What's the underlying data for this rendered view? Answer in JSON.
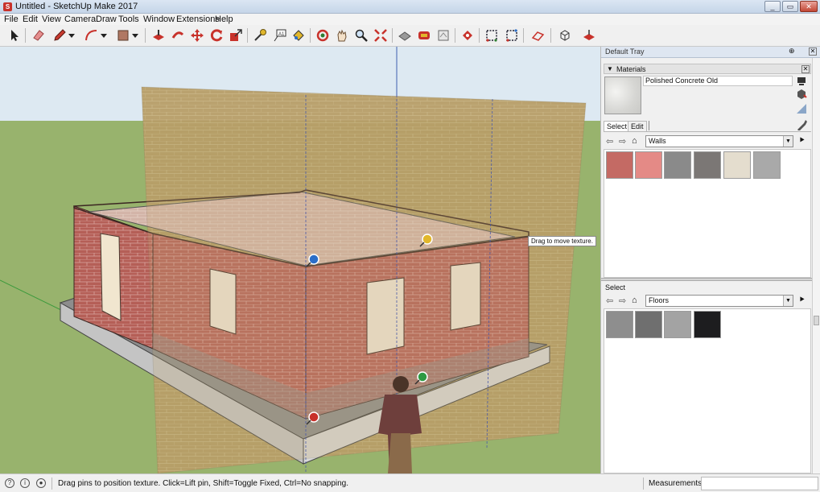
{
  "window": {
    "title": "Untitled - SketchUp Make 2017",
    "app_icon_glyph": "S"
  },
  "window_controls": [
    "minimize-button",
    "maximize-button",
    "close-button"
  ],
  "menu": [
    "File",
    "Edit",
    "View",
    "Camera",
    "Draw",
    "Tools",
    "Window",
    "Extensions",
    "Help"
  ],
  "toolbar_icons": [
    "select-icon",
    "eraser-icon",
    "pencil-icon",
    "arc-icon",
    "rectangle-icon",
    "push-pull-icon",
    "follow-me-icon",
    "move-icon",
    "rotate-icon",
    "scale-icon",
    "tape-measure-icon",
    "text-icon",
    "paint-bucket-icon",
    "orbit-icon",
    "pan-icon",
    "zoom-icon",
    "zoom-extents-icon",
    "3d-warehouse-icon",
    "extension-warehouse-icon",
    "layout-icon",
    "extension-manager-icon",
    "section-plane-icon",
    "section-display-icon",
    "axes-icon",
    "iso-view-icon",
    "top-view-icon"
  ],
  "viewport": {
    "tooltip": "Drag to move texture.",
    "pins": [
      "blue-pin-icon",
      "yellow-pin-icon",
      "green-pin-icon",
      "red-pin-icon"
    ]
  },
  "tray": {
    "title": "Default Tray",
    "materials_title": "Materials",
    "material_name": "Polished Concrete Old",
    "tabs": {
      "select": "Select",
      "edit": "Edit"
    },
    "upper_collection": "Walls",
    "lower_label": "Select",
    "lower_collection": "Floors",
    "wall_swatches": [
      "#c46a64",
      "#e48a86",
      "#8a8a8a",
      "#7b7775",
      "#e4ddce",
      "#a9a9a9"
    ],
    "floor_swatches": [
      "#8e8e8e",
      "#6f6f6f",
      "#a3a3a3",
      "#1d1d1f"
    ]
  },
  "status": {
    "text": "Drag pins to position texture.  Click=Lift pin, Shift=Toggle Fixed, Ctrl=No snapping.",
    "measurements_label": "Measurements",
    "measurements_value": ""
  },
  "colors": {
    "sky": "#dde9f2",
    "ground": "#98b36d",
    "brick": "#b55f57",
    "texture_plane": "#b59c67",
    "accent_red": "#c8322b"
  }
}
